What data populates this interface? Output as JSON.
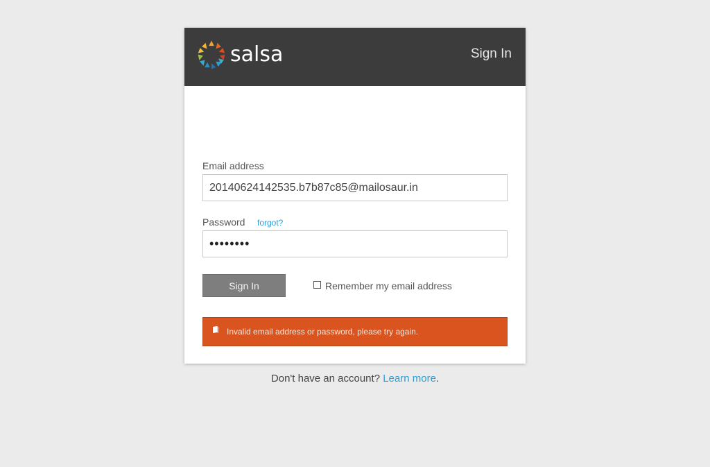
{
  "brand": {
    "name": "salsa",
    "accent": "#d9541e",
    "link_color": "#2a9fd6"
  },
  "header": {
    "title": "Sign In"
  },
  "form": {
    "email_label": "Email address",
    "email_value": "20140624142535.b7b87c85@mailosaur.in",
    "password_label": "Password",
    "forgot_link": "forgot?",
    "password_value": "••••••••",
    "submit_label": "Sign In",
    "remember_label": "Remember my email address",
    "remember_checked": false
  },
  "alert": {
    "icon": "alert-icon",
    "message": "Invalid email address or password, please try again."
  },
  "footer": {
    "prompt": "Don't have an account? ",
    "link": "Learn more",
    "suffix": "."
  }
}
